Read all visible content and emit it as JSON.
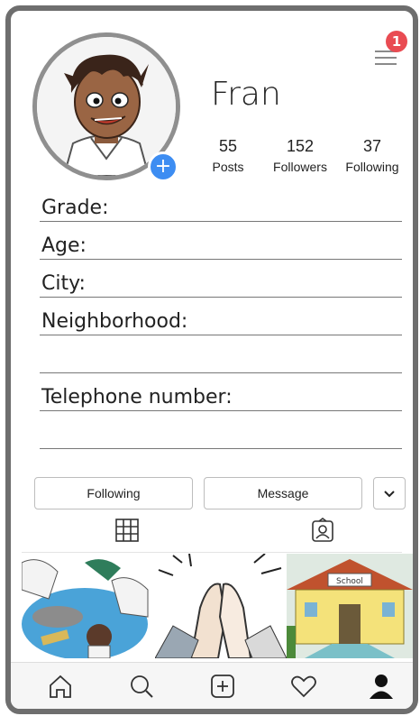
{
  "profile": {
    "username": "Fran",
    "notification_count": "1"
  },
  "stats": [
    {
      "value": "55",
      "label": "Posts"
    },
    {
      "value": "152",
      "label": "Followers"
    },
    {
      "value": "37",
      "label": "Following"
    }
  ],
  "fields": {
    "grade": "Grade:",
    "age": "Age:",
    "city": "City:",
    "neighborhood": "Neighborhood:",
    "telephone": "Telephone number:"
  },
  "actions": {
    "following_label": "Following",
    "message_label": "Message"
  },
  "icons": {
    "menu": "menu-icon",
    "add": "plus-icon",
    "grid": "grid-icon",
    "tagged": "portrait-icon",
    "more": "chevron-down-icon",
    "nav": [
      "home-icon",
      "search-icon",
      "add-post-icon",
      "heart-icon",
      "profile-icon"
    ]
  },
  "colors": {
    "badge_red": "#e94b52",
    "add_blue": "#3d8df2",
    "frame_gray": "#6e6e6e"
  }
}
